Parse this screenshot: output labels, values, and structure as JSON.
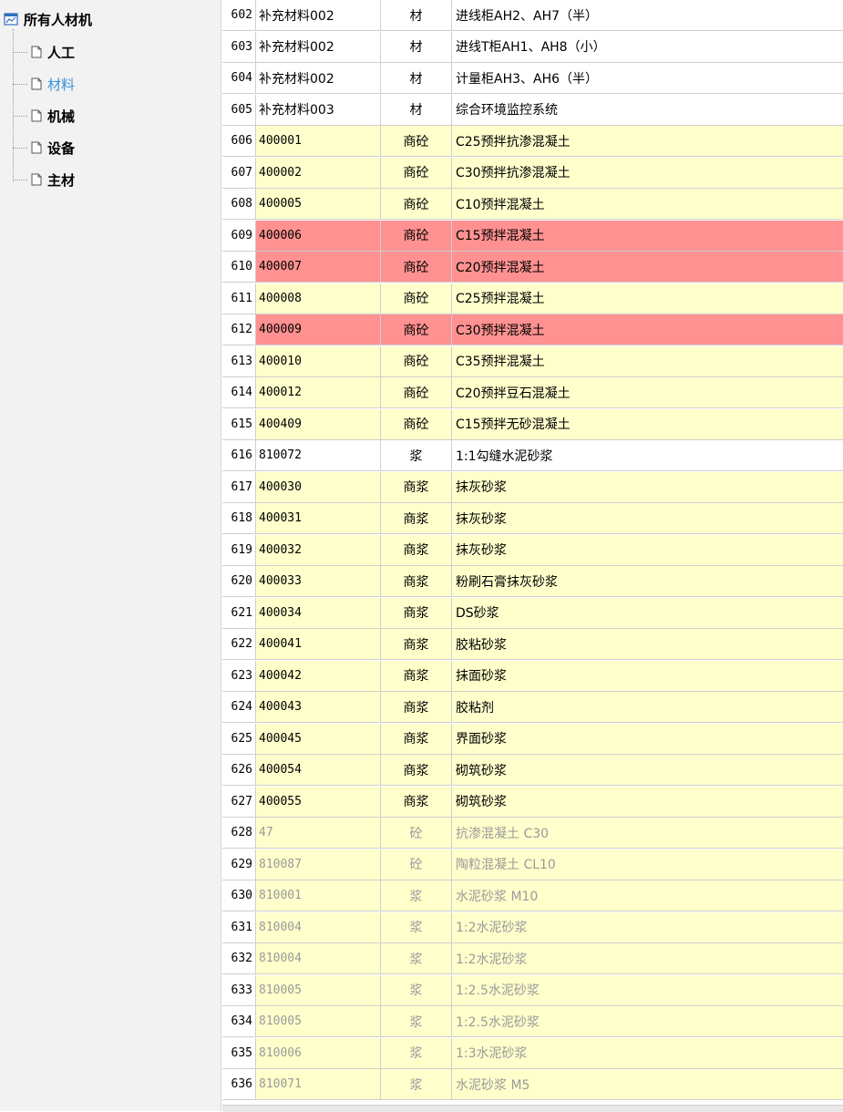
{
  "tree": {
    "root_label": "所有人材机",
    "items": [
      {
        "label": "人工",
        "selected": false
      },
      {
        "label": "材料",
        "selected": true
      },
      {
        "label": "机械",
        "selected": false
      },
      {
        "label": "设备",
        "selected": false
      },
      {
        "label": "主材",
        "selected": false
      }
    ]
  },
  "colors": {
    "yellow_row": "#ffffcc",
    "red_row": "#ff9191",
    "gray_text": "#9a9a9a",
    "selected_tree": "#3b8fd9"
  },
  "rows": [
    {
      "num": "602",
      "code": "补充材料002",
      "type": "材",
      "name": "进线柜AH2、AH7（半）",
      "style": "white"
    },
    {
      "num": "603",
      "code": "补充材料002",
      "type": "材",
      "name": "进线T柜AH1、AH8（小）",
      "style": "white"
    },
    {
      "num": "604",
      "code": "补充材料002",
      "type": "材",
      "name": "计量柜AH3、AH6（半）",
      "style": "white"
    },
    {
      "num": "605",
      "code": "补充材料003",
      "type": "材",
      "name": "综合环境监控系统",
      "style": "white"
    },
    {
      "num": "606",
      "code": "400001",
      "type": "商砼",
      "name": "C25预拌抗渗混凝土",
      "style": "yellow"
    },
    {
      "num": "607",
      "code": "400002",
      "type": "商砼",
      "name": "C30预拌抗渗混凝土",
      "style": "yellow"
    },
    {
      "num": "608",
      "code": "400005",
      "type": "商砼",
      "name": "C10预拌混凝土",
      "style": "yellow"
    },
    {
      "num": "609",
      "code": "400006",
      "type": "商砼",
      "name": "C15预拌混凝土",
      "style": "red"
    },
    {
      "num": "610",
      "code": "400007",
      "type": "商砼",
      "name": "C20预拌混凝土",
      "style": "red"
    },
    {
      "num": "611",
      "code": "400008",
      "type": "商砼",
      "name": "C25预拌混凝土",
      "style": "yellow"
    },
    {
      "num": "612",
      "code": "400009",
      "type": "商砼",
      "name": "C30预拌混凝土",
      "style": "red"
    },
    {
      "num": "613",
      "code": "400010",
      "type": "商砼",
      "name": "C35预拌混凝土",
      "style": "yellow"
    },
    {
      "num": "614",
      "code": "400012",
      "type": "商砼",
      "name": "C20预拌豆石混凝土",
      "style": "yellow"
    },
    {
      "num": "615",
      "code": "400409",
      "type": "商砼",
      "name": "C15预拌无砂混凝土",
      "style": "yellow"
    },
    {
      "num": "616",
      "code": "810072",
      "type": "浆",
      "name": "1:1勾缝水泥砂浆",
      "style": "white"
    },
    {
      "num": "617",
      "code": "400030",
      "type": "商浆",
      "name": "抹灰砂浆",
      "style": "yellow"
    },
    {
      "num": "618",
      "code": "400031",
      "type": "商浆",
      "name": "抹灰砂浆",
      "style": "yellow"
    },
    {
      "num": "619",
      "code": "400032",
      "type": "商浆",
      "name": "抹灰砂浆",
      "style": "yellow"
    },
    {
      "num": "620",
      "code": "400033",
      "type": "商浆",
      "name": "粉刷石膏抹灰砂浆",
      "style": "yellow"
    },
    {
      "num": "621",
      "code": "400034",
      "type": "商浆",
      "name": "DS砂浆",
      "style": "yellow"
    },
    {
      "num": "622",
      "code": "400041",
      "type": "商浆",
      "name": "胶粘砂浆",
      "style": "yellow"
    },
    {
      "num": "623",
      "code": "400042",
      "type": "商浆",
      "name": "抹面砂浆",
      "style": "yellow"
    },
    {
      "num": "624",
      "code": "400043",
      "type": "商浆",
      "name": "胶粘剂",
      "style": "yellow"
    },
    {
      "num": "625",
      "code": "400045",
      "type": "商浆",
      "name": "界面砂浆",
      "style": "yellow"
    },
    {
      "num": "626",
      "code": "400054",
      "type": "商浆",
      "name": "砌筑砂浆",
      "style": "yellow"
    },
    {
      "num": "627",
      "code": "400055",
      "type": "商浆",
      "name": "砌筑砂浆",
      "style": "yellow"
    },
    {
      "num": "628",
      "code": "47",
      "type": "砼",
      "name": "抗渗混凝土 C30",
      "style": "yellow gray"
    },
    {
      "num": "629",
      "code": "810087",
      "type": "砼",
      "name": "陶粒混凝土 CL10",
      "style": "yellow gray"
    },
    {
      "num": "630",
      "code": "810001",
      "type": "浆",
      "name": "水泥砂浆 M10",
      "style": "yellow gray"
    },
    {
      "num": "631",
      "code": "810004",
      "type": "浆",
      "name": "1:2水泥砂浆",
      "style": "yellow gray"
    },
    {
      "num": "632",
      "code": "810004",
      "type": "浆",
      "name": "1:2水泥砂浆",
      "style": "yellow gray"
    },
    {
      "num": "633",
      "code": "810005",
      "type": "浆",
      "name": "1:2.5水泥砂浆",
      "style": "yellow gray"
    },
    {
      "num": "634",
      "code": "810005",
      "type": "浆",
      "name": "1:2.5水泥砂浆",
      "style": "yellow gray"
    },
    {
      "num": "635",
      "code": "810006",
      "type": "浆",
      "name": "1:3水泥砂浆",
      "style": "yellow gray"
    },
    {
      "num": "636",
      "code": "810071",
      "type": "浆",
      "name": "水泥砂浆 M5",
      "style": "yellow gray"
    }
  ]
}
